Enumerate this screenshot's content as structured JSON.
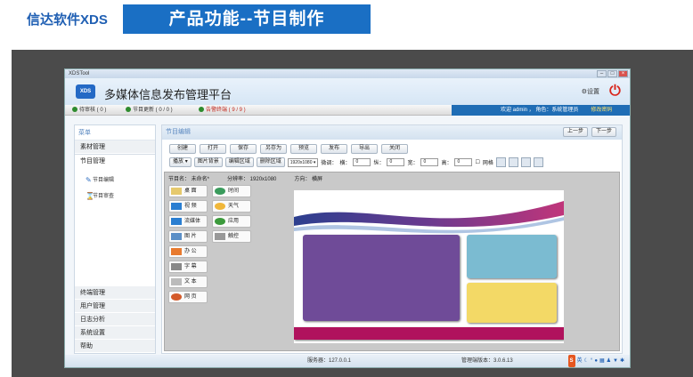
{
  "slide": {
    "brand": "信达软件XDS",
    "title": "产品功能--节目制作"
  },
  "window": {
    "caption": "XDSTool",
    "logo_text": "XDS",
    "app_title": "多媒体信息发布管理平台",
    "settings_label": "设置"
  },
  "statusbar": {
    "pending": "待审核 ( 0 )",
    "updates": "节目更新 ( 0 / 0 )",
    "alarms": "告警终端 ( 9 / 9 )",
    "welcome": "欢迎 admin ， 角色：系统管理员",
    "change_password": "修改密码"
  },
  "sidebar": {
    "header": "菜单",
    "items": [
      "素材管理",
      "节目管理"
    ],
    "subitems": [
      "节目编辑",
      "节目审查"
    ],
    "bottom_items": [
      "终端管理",
      "用户管理",
      "日志分析",
      "系统设置",
      "帮助"
    ]
  },
  "editor": {
    "header": "节目编辑",
    "prev": "上一步",
    "next": "下一步",
    "toolbar": [
      "创建",
      "打开",
      "保存",
      "另存为",
      "预览",
      "发布",
      "导出",
      "关闭"
    ],
    "play_label": "播放",
    "bg_label": "图片背景",
    "edit_area": "编辑区域",
    "delete_area": "删除区域",
    "resolution": "1920x1080",
    "fine_label": "微调：",
    "h_label": "横：",
    "v_label": "纵：",
    "w_label": "宽：",
    "ht_label": "高：",
    "h_val": "0",
    "v_val": "0",
    "w_val": "0",
    "ht_val": "0",
    "grid_label": "网格",
    "prog_name": "节目名：  未命名*",
    "prog_res": "分辨率：  1920x1080",
    "prog_dir": "方向：  横屏"
  },
  "widgets": {
    "col1": [
      "桌 面",
      "视 频",
      "流媒体",
      "图 片",
      "办 公",
      "字 幕",
      "文 本",
      "网 页"
    ],
    "col2": [
      "时间",
      "天气",
      "应用",
      "触控"
    ]
  },
  "footer": {
    "server": "服务器：127.0.0.1",
    "version": "管理端版本：3.0.6.13",
    "ime": "英"
  },
  "colors": {
    "zone_main": "#6f4b98",
    "zone_top_right": "#7bbbd1",
    "zone_bottom_right": "#f3d966",
    "zone_strip": "#b0125d",
    "accent": "#1a6fc4"
  }
}
